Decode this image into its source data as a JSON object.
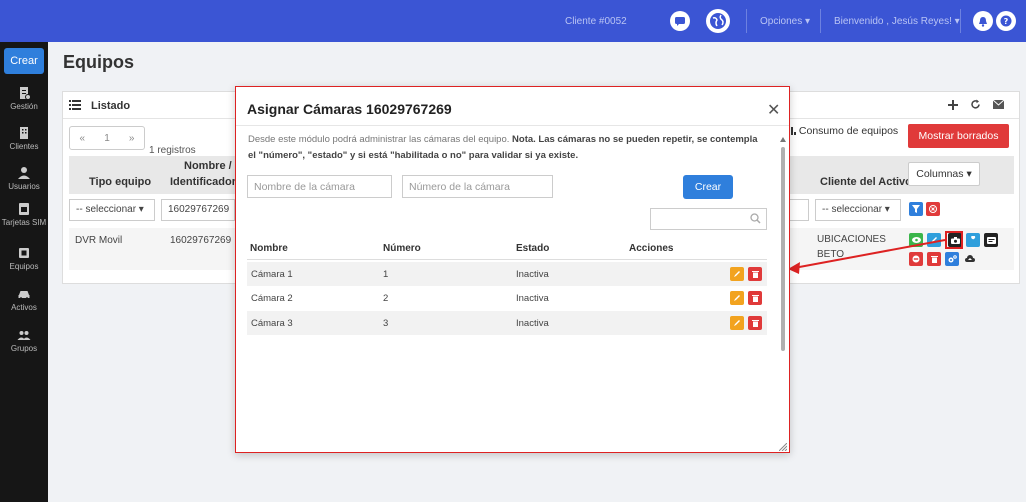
{
  "topbar": {
    "client": "Cliente #0052",
    "opciones": "Opciones",
    "welcome": "Bienvenido , Jesús Reyes!"
  },
  "sidebar": {
    "crear": "Crear",
    "items": [
      {
        "label": "Gestión"
      },
      {
        "label": "Clientes"
      },
      {
        "label": "Usuarios"
      },
      {
        "label": "Tarjetas SIM"
      },
      {
        "label": "Equipos"
      },
      {
        "label": "Activos"
      },
      {
        "label": "Grupos"
      }
    ]
  },
  "page": {
    "title": "Equipos",
    "panel_label": "Listado",
    "pager": {
      "prev": "«",
      "page": "1",
      "next": "»"
    },
    "registros": "1 registros",
    "consumo": "Consumo de equipos",
    "mostrar_borrados": "Mostrar borrados",
    "columnas": "Columnas",
    "headers": {
      "tipo_equipo": "Tipo equipo",
      "nombre_id_1": "Nombre /",
      "nombre_id_2": "Identificador",
      "cliente_activo": "Cliente del Activo"
    },
    "filters": {
      "tipo": "-- seleccionar",
      "identificador": "16029767269",
      "cliente": "-- seleccionar"
    },
    "row": {
      "tipo": "DVR Movil",
      "identificador": "16029767269",
      "cliente_1": "UBICACIONES",
      "cliente_2": "BETO"
    }
  },
  "modal": {
    "title": "Asignar Cámaras 16029767269",
    "desc_pre": "Desde este módulo podrá administrar las cámaras del equipo.",
    "desc_nota": "Nota. Las cámaras no se pueden repetir, se contempla el \"número\", \"estado\" y si está \"habilitada o no\" para validar si ya existe.",
    "nombre_placeholder": "Nombre de la cámara",
    "numero_placeholder": "Número de la cámara",
    "crear": "Crear",
    "columns": {
      "nombre": "Nombre",
      "numero": "Número",
      "estado": "Estado",
      "acciones": "Acciones"
    },
    "rows": [
      {
        "nombre": "Cámara 1",
        "numero": "1",
        "estado": "Inactiva"
      },
      {
        "nombre": "Cámara 2",
        "numero": "2",
        "estado": "Inactiva"
      },
      {
        "nombre": "Cámara 3",
        "numero": "3",
        "estado": "Inactiva"
      }
    ]
  },
  "colors": {
    "topbar": "#3b55d4",
    "primary": "#2f7fdc",
    "danger": "#e03a3a",
    "warning": "#f2a31f",
    "annotation": "#dd2222"
  }
}
